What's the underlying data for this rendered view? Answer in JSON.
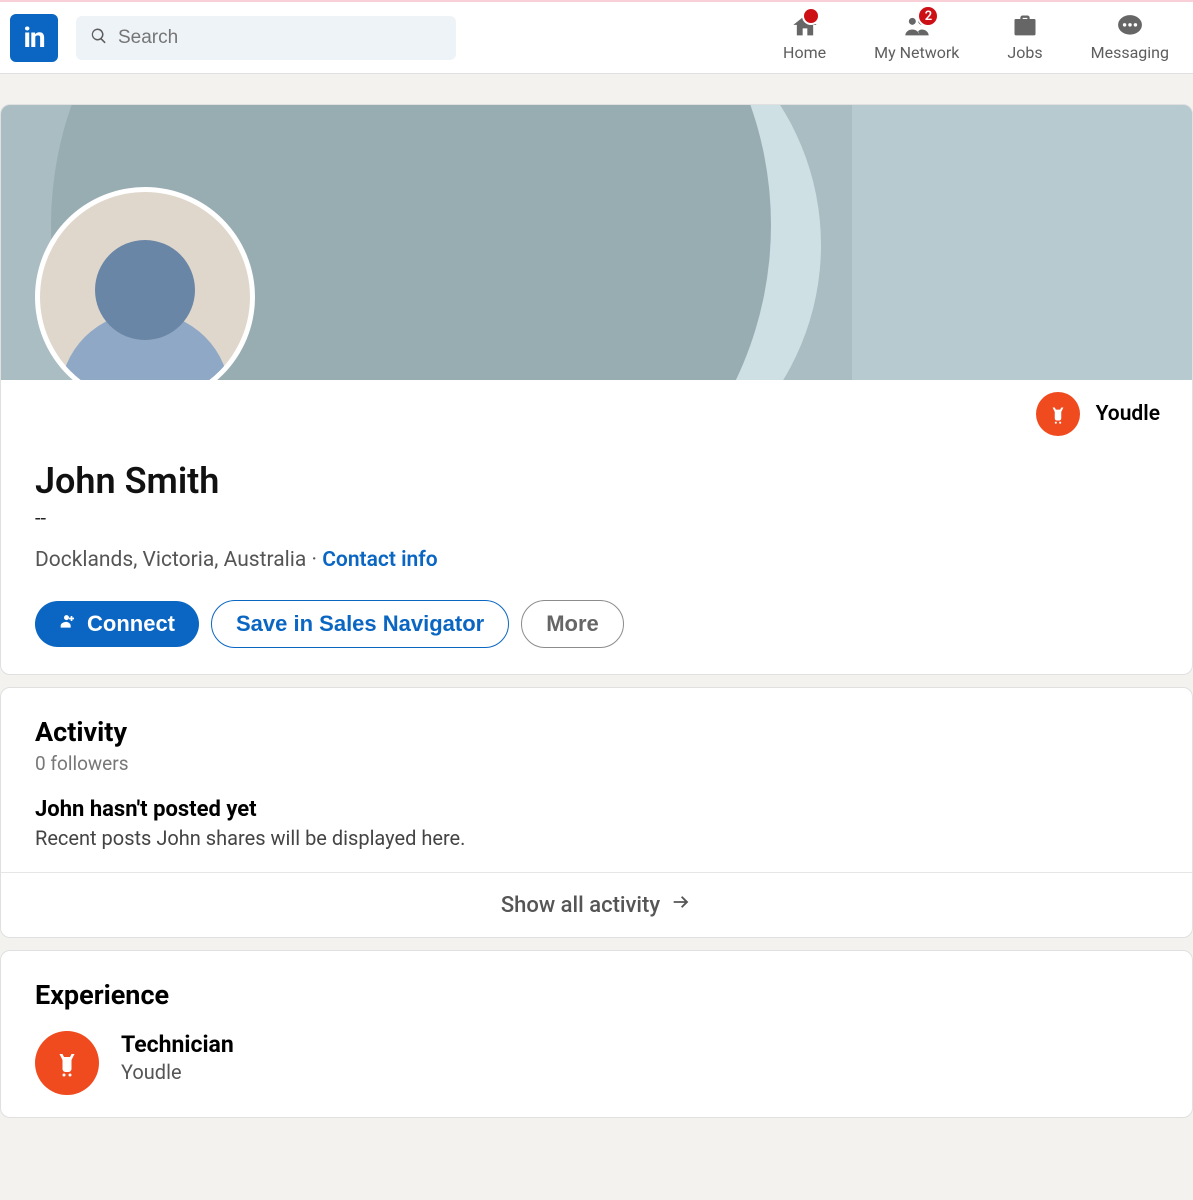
{
  "search": {
    "placeholder": "Search"
  },
  "nav": {
    "home": "Home",
    "network": "My Network",
    "jobs": "Jobs",
    "messaging": "Messaging",
    "network_badge": "2"
  },
  "profile": {
    "name": "John Smith",
    "headline": "--",
    "location": "Docklands, Victoria, Australia",
    "contact_link": "Contact info",
    "company_name": "Youdle"
  },
  "actions": {
    "connect": "Connect",
    "save": "Save in Sales Navigator",
    "more": "More"
  },
  "activity": {
    "title": "Activity",
    "followers": "0 followers",
    "empty_title": "John hasn't posted yet",
    "empty_body": "Recent posts John shares will be displayed here.",
    "show_all": "Show all activity"
  },
  "experience": {
    "title": "Experience",
    "items": [
      {
        "role": "Technician",
        "company": "Youdle"
      }
    ]
  }
}
